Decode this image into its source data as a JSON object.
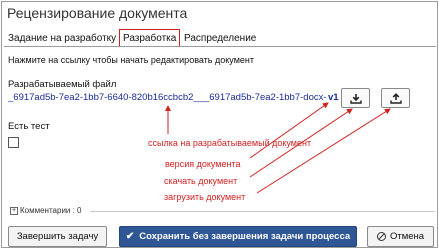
{
  "window": {
    "title": "Рецензирование документа"
  },
  "tabs": [
    {
      "label": "Задание на разработку"
    },
    {
      "label": "Разработка"
    },
    {
      "label": "Распределение"
    }
  ],
  "hint": "Нажмите на ссылку чтобы начать редактировать документ",
  "file": {
    "label": "Разрабатываемый файл",
    "link": "_6917ad5b-7ea2-1bb7-6640-820b16ccbcb2___6917ad5b-7ea2-1bb7-docx-",
    "version": "v1"
  },
  "test": {
    "label": "Есть тест"
  },
  "annotations": {
    "link": "ссылка на разрабатываемый документ",
    "version": "версия документа",
    "download": "скачать документ",
    "upload": "загрузить документ"
  },
  "comments": {
    "label": "Комментарии : 0"
  },
  "buttons": {
    "finish": "Завершить задачу",
    "save": "Сохранить без завершения задачи процесса",
    "cancel": "Отмена"
  },
  "colors": {
    "accent": "#2f5796",
    "annotation": "#d32121",
    "link": "#1a2c9a"
  },
  "icons": [
    "download-icon",
    "upload-icon",
    "check-icon",
    "cancel-icon",
    "expand-icon"
  ]
}
